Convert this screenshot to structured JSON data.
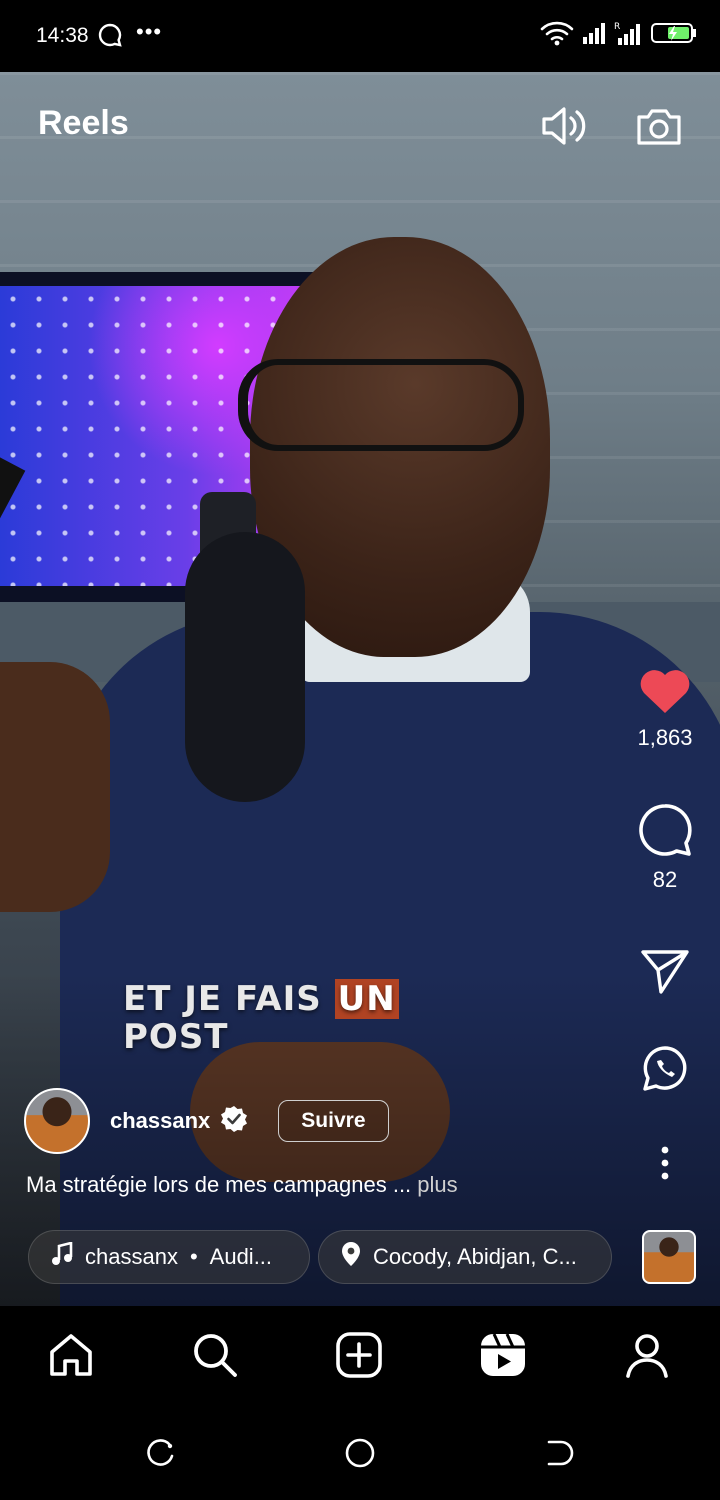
{
  "status_bar": {
    "time": "14:38",
    "dots": "•••",
    "icons": [
      "chat-bubble-icon",
      "wifi-icon",
      "signal-icon",
      "signal-r-icon",
      "battery-charging-icon"
    ]
  },
  "header": {
    "title": "Reels",
    "icons": [
      "speaker-icon",
      "camera-icon"
    ]
  },
  "video": {
    "caption_line1": "ET JE FAIS",
    "caption_highlight": "UN",
    "caption_line2": "POST"
  },
  "actions": {
    "like_count": "1,863",
    "comment_count": "82",
    "icons": [
      "heart-icon",
      "comment-icon",
      "share-icon",
      "whatsapp-icon",
      "more-icon"
    ],
    "like_color": "#ed4956"
  },
  "author": {
    "username": "chassanx",
    "follow_label": "Suivre",
    "description": "Ma stratégie lors de mes campagnes ...",
    "more_label": " plus"
  },
  "chips": {
    "audio_user": "chassanx",
    "audio_bullet": "•",
    "audio_text": "Audi...",
    "location_text": "Cocody, Abidjan, C..."
  },
  "bottom_nav": {
    "items": [
      "home-icon",
      "search-icon",
      "create-icon",
      "reels-icon",
      "profile-icon"
    ]
  },
  "system_nav": {
    "items": [
      "recents-icon",
      "home-circle-icon",
      "back-icon"
    ]
  }
}
